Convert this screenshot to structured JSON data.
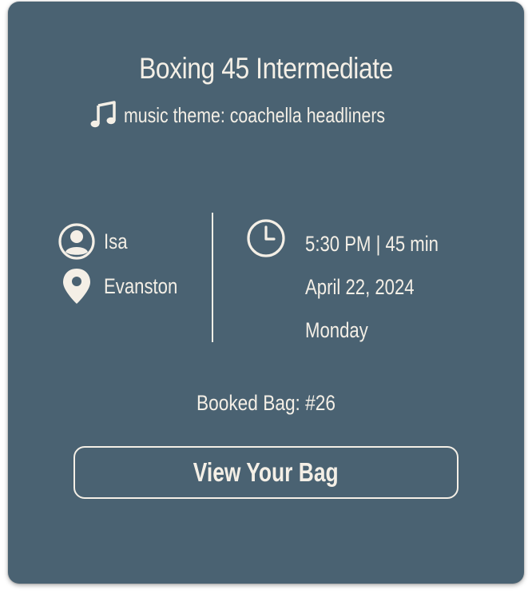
{
  "card": {
    "title": "Boxing 45 Intermediate",
    "music_theme": "music theme: coachella headliners",
    "music_icon": "music-note-icon"
  },
  "details": {
    "instructor": {
      "icon": "user-icon",
      "label": "Isa"
    },
    "location": {
      "icon": "location-pin-icon",
      "label": "Evanston"
    },
    "schedule": {
      "icon": "clock-icon",
      "time": "5:30 PM | 45 min",
      "date": "April 22, 2024",
      "weekday": "Monday"
    }
  },
  "booking": {
    "booked_bag": "Booked Bag: #26",
    "view_button_label": "View Your Bag"
  },
  "colors": {
    "card_background": "#4a6272",
    "text": "#f4efe6"
  }
}
